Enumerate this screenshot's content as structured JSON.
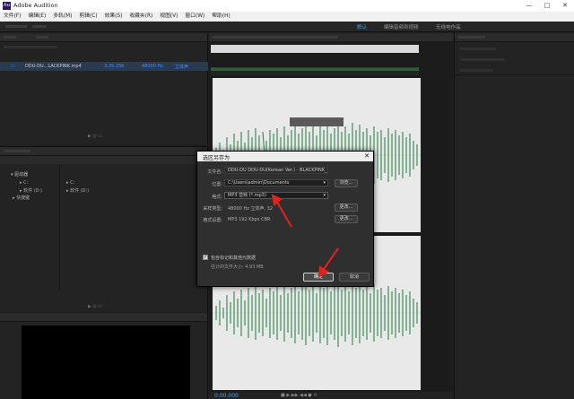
{
  "window": {
    "title": "Adobe Audition",
    "logo": "Au",
    "minimize": "—",
    "maximize": "□",
    "close": "✕"
  },
  "menu": [
    "文件(F)",
    "编辑(E)",
    "多轨(M)",
    "剪辑(C)",
    "效果(S)",
    "收藏夹(R)",
    "视图(V)",
    "窗口(W)",
    "帮助(H)"
  ],
  "toolbar": {
    "workspaces": [
      "默认",
      "编辑音频到视频",
      "无线电作品"
    ]
  },
  "files": {
    "row": {
      "name": "DDU-DU...LACKPINK.mp4",
      "duration": "3:35.256",
      "rate": "48000 Hz",
      "channels": "立体声"
    }
  },
  "media": {
    "tree_root": "驱动器",
    "tree_items": [
      "C:",
      "软件 (D:)",
      "快捷键"
    ],
    "list_items": [
      "C:",
      "软件 (D:)"
    ]
  },
  "editor": {
    "time": "0:00.000"
  },
  "right": {
    "groups": []
  },
  "dialog": {
    "title": "选区另存为",
    "filename_label": "文件名:",
    "filename_value": "DDU-DU DDU-DU(Korean Ver.) - BLACKPINK_E",
    "location_label": "位置:",
    "location_value": "C:\\Users\\admin\\Documents",
    "browse": "浏览...",
    "format_label": "格式:",
    "format_value": "MP3 音频 (*.mp3)",
    "sample_label": "采样类型:",
    "sample_value": "48000 Hz 立体声, 32",
    "change1": "更改...",
    "format_settings_label": "格式设置:",
    "format_settings_value": "MP3 192 Kbps CBR",
    "change2": "更改...",
    "checkbox_label": "包含标记和其他元数据",
    "size_text": "估计的文件大小: 4.93 MB",
    "ok": "确定",
    "cancel": "取消"
  },
  "colors": {
    "accent_blue": "#3fa2ff",
    "waveform": "#3f8f5b",
    "arrow": "#e0241b"
  }
}
